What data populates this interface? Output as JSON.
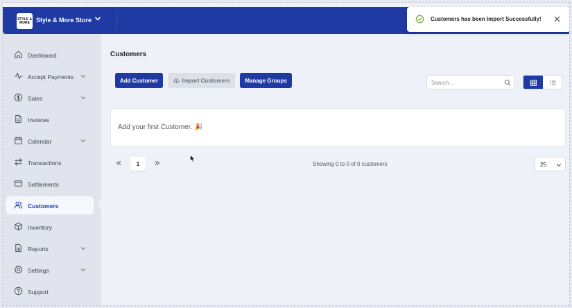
{
  "store": {
    "name": "Style & More Store",
    "logo_text": "STYLE & MORE"
  },
  "toast": {
    "message": "Customers has been Import Successfully!",
    "color": "#7cb342"
  },
  "sidebar": {
    "items": [
      {
        "label": "Dashboard",
        "icon": "home-icon"
      },
      {
        "label": "Accept Payments",
        "icon": "activity-icon"
      },
      {
        "label": "Sales",
        "icon": "dollar-icon"
      },
      {
        "label": "Invoices",
        "icon": "document-icon"
      },
      {
        "label": "Calendar",
        "icon": "calendar-icon"
      },
      {
        "label": "Transactions",
        "icon": "transfer-icon"
      },
      {
        "label": "Settlements",
        "icon": "card-icon"
      },
      {
        "label": "Customers",
        "icon": "users-icon",
        "active": true
      },
      {
        "label": "Inventory",
        "icon": "box-icon"
      },
      {
        "label": "Reports",
        "icon": "chart-icon"
      },
      {
        "label": "Settings",
        "icon": "gear-icon"
      },
      {
        "label": "Support",
        "icon": "help-icon"
      }
    ]
  },
  "page": {
    "title": "Customers"
  },
  "toolbar": {
    "add_label": "Add Customer",
    "import_label": "Import Customers",
    "groups_label": "Manage Groups"
  },
  "search": {
    "placeholder": "Search..."
  },
  "empty_state": {
    "text": "Add your first Customer. 🎉"
  },
  "pagination": {
    "current_page": "1",
    "showing": "Showing 0 to 0 of 0 customers",
    "per_page": "25"
  },
  "colors": {
    "primary": "#1f3aa3",
    "sidebar_bg": "#e1e4ec",
    "page_bg": "#eef1f8"
  }
}
